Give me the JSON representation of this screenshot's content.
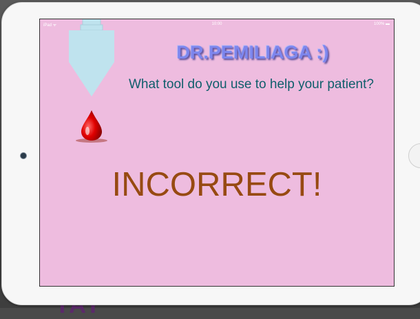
{
  "status_bar": {
    "carrier": "iPad ᯤ",
    "time": "10:00",
    "battery": "100% ▬"
  },
  "screen": {
    "title": "DR.PEMILIAGA :)",
    "question": "What tool do you use to help your patient?",
    "result": "INCORRECT!"
  },
  "colors": {
    "screen_bg": "#eebcdf",
    "title": "#7d86ee",
    "question": "#0f5e6b",
    "result": "#974a12",
    "arrow": "#bfe3ee",
    "blood_drop": "#e00000"
  },
  "icons": {
    "arrow": "down-arrow-icon",
    "drop": "blood-drop-icon",
    "camera": "camera-icon",
    "home": "home-button"
  }
}
